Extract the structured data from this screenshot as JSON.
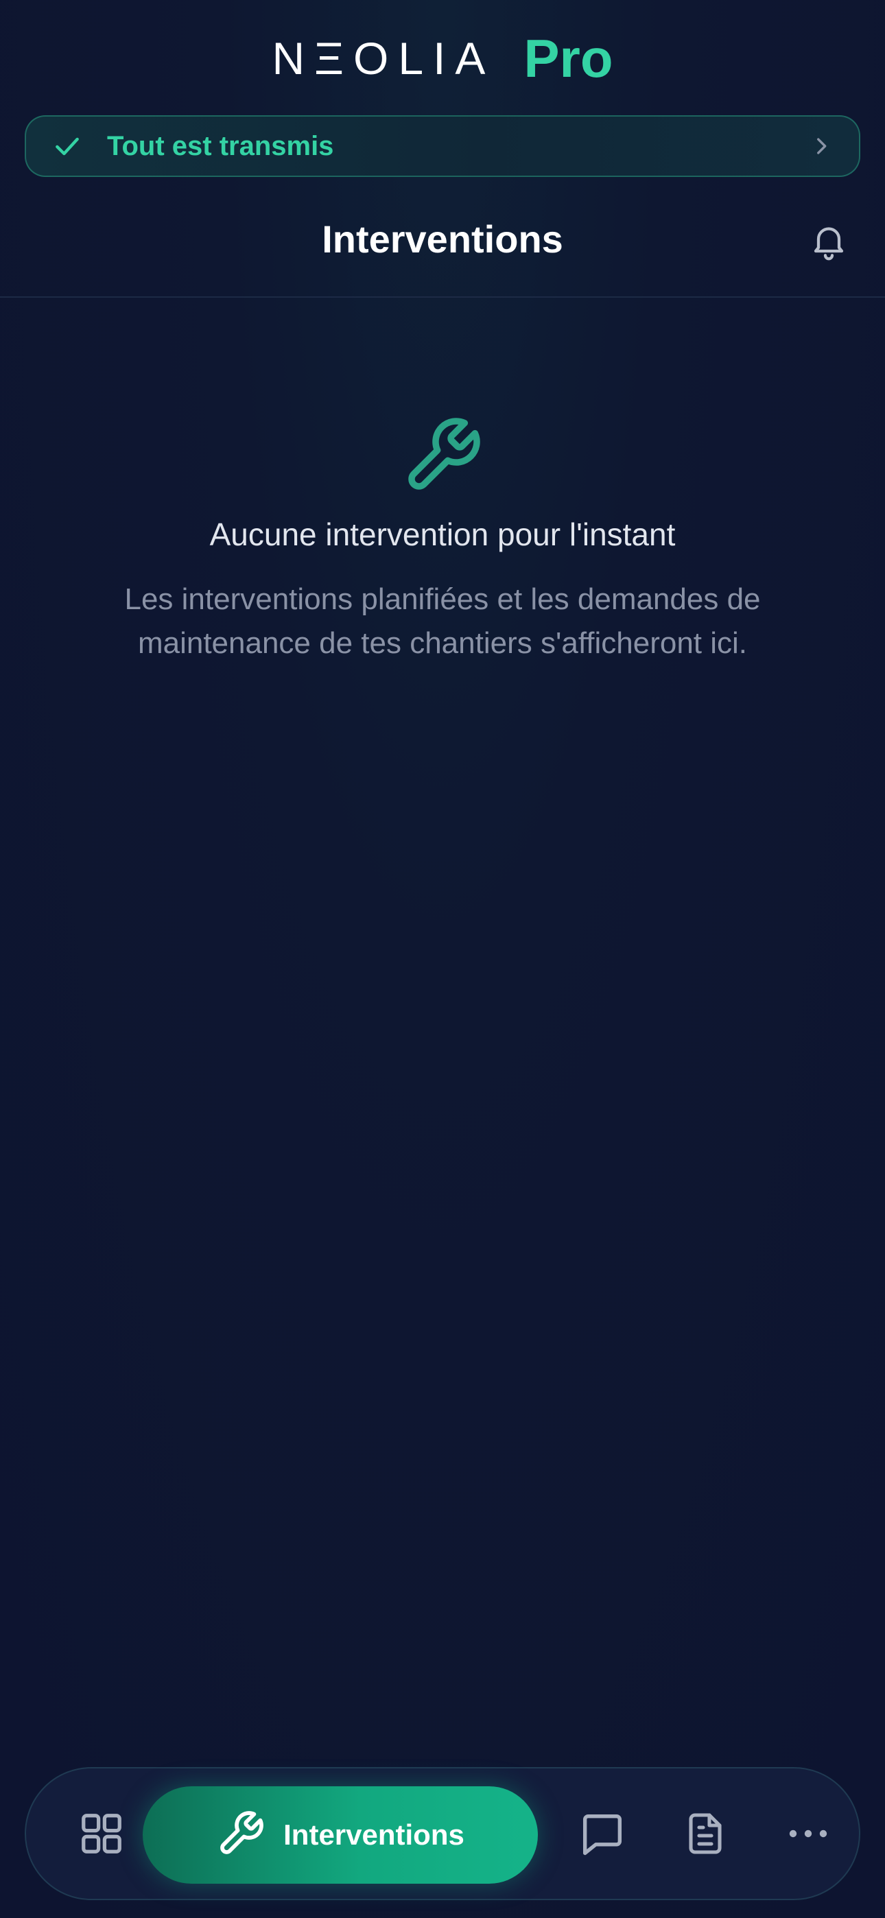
{
  "brand": {
    "name": "NΞOLIA",
    "suffix": "Pro"
  },
  "sync_banner": {
    "text": "Tout est transmis",
    "check_icon": "check-icon",
    "chevron_icon": "chevron-right-icon"
  },
  "topbar": {
    "title": "Interventions",
    "bell_icon": "bell-icon"
  },
  "empty_state": {
    "icon": "wrench-icon",
    "title": "Aucune intervention pour l'instant",
    "description": "Les interventions planifiées et les demandes de maintenance de tes chantiers s'afficheront ici."
  },
  "bottom_nav": {
    "items": [
      {
        "icon": "grid-icon"
      },
      {
        "icon": "wrench-icon",
        "label": "Interventions",
        "active": true
      },
      {
        "icon": "chat-bubble-icon"
      },
      {
        "icon": "document-icon"
      },
      {
        "icon": "more-dots-icon"
      }
    ]
  },
  "colors": {
    "accent": "#34d3a4",
    "background": "#0d1530",
    "nav_active": "#12a87f"
  }
}
